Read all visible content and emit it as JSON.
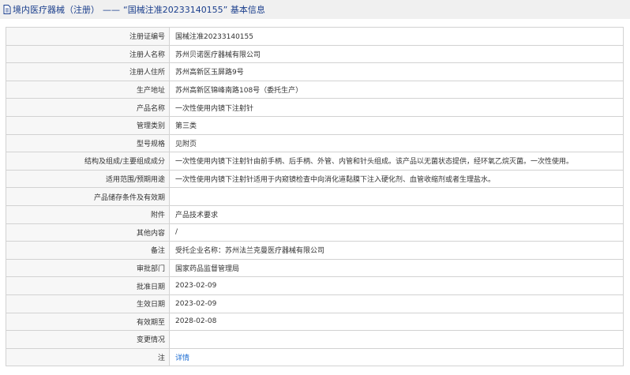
{
  "header": {
    "category": "境内医疗器械（注册）",
    "separator": "——",
    "record_title": "“国械注准20233140155” 基本信息"
  },
  "rows": [
    {
      "label": "注册证编号",
      "value": "国械注准20233140155"
    },
    {
      "label": "注册人名称",
      "value": "苏州贝诺医疗器械有限公司"
    },
    {
      "label": "注册人住所",
      "value": "苏州高新区玉屏路9号"
    },
    {
      "label": "生产地址",
      "value": "苏州高新区锦峰南路108号（委托生产）"
    },
    {
      "label": "产品名称",
      "value": "一次性使用内镜下注射针"
    },
    {
      "label": "管理类别",
      "value": "第三类"
    },
    {
      "label": "型号规格",
      "value": "见附页"
    },
    {
      "label": "结构及组成/主要组成成分",
      "value": "一次性使用内镜下注射针由前手柄、后手柄、外管、内管和针头组成。该产品以无菌状态提供，经环氧乙烷灭菌。一次性使用。"
    },
    {
      "label": "适用范围/预期用途",
      "value": "一次性使用内镜下注射针适用于内窥镜检查中向消化道黏膜下注入硬化剂、血管收缩剂或者生理盐水。"
    },
    {
      "label": "产品储存条件及有效期",
      "value": ""
    },
    {
      "label": "附件",
      "value": "产品技术要求"
    },
    {
      "label": "其他内容",
      "value": "/"
    },
    {
      "label": "备注",
      "value": "受托企业名称：苏州法兰克曼医疗器械有限公司"
    },
    {
      "label": "审批部门",
      "value": "国家药品监督管理局"
    },
    {
      "label": "批准日期",
      "value": "2023-02-09"
    },
    {
      "label": "生效日期",
      "value": "2023-02-09"
    },
    {
      "label": "有效期至",
      "value": "2028-02-08"
    },
    {
      "label": "变更情况",
      "value": ""
    },
    {
      "label": "注",
      "value": "详情",
      "link": true
    }
  ]
}
